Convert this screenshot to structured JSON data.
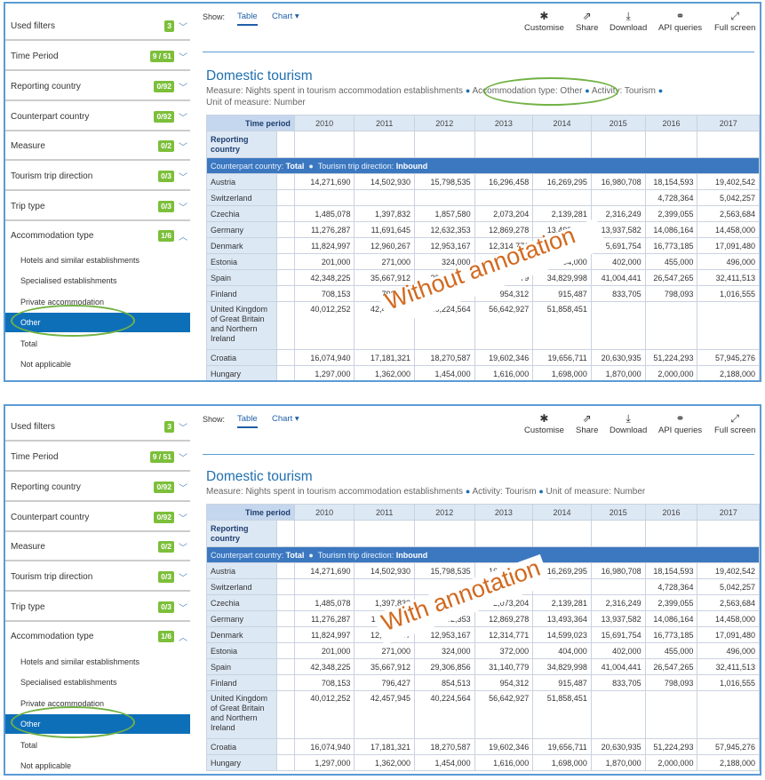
{
  "colors": {
    "accent": "#1f6fb0",
    "badge": "#7cbf3a",
    "selected": "#0e6fb9",
    "annotation_oval": "#71b244",
    "watermark": "#d2691e"
  },
  "filters": [
    {
      "label": "Used filters",
      "badge": "3"
    },
    {
      "label": "Time Period",
      "badge": "9 / 51"
    },
    {
      "label": "Reporting country",
      "badge": "0/92"
    },
    {
      "label": "Counterpart country",
      "badge": "0/92"
    },
    {
      "label": "Measure",
      "badge": "0/2"
    },
    {
      "label": "Tourism trip direction",
      "badge": "0/3"
    },
    {
      "label": "Trip type",
      "badge": "0/3"
    },
    {
      "label": "Accommodation type",
      "badge": "1/6"
    }
  ],
  "accommodation_options": [
    "Hotels and similar establishments",
    "Specialised establishments",
    "Private accommodation",
    "Other",
    "Total",
    "Not applicable"
  ],
  "toolbar": {
    "show": "Show:",
    "table": "Table",
    "chart": "Chart",
    "customise": "Customise",
    "share": "Share",
    "download": "Download",
    "api": "API queries",
    "fullscreen": "Full screen",
    "icons": [
      "gear-icon",
      "share-icon",
      "download-icon",
      "link-icon",
      "fullscreen-icon"
    ]
  },
  "title": "Domestic tourism",
  "panel1": {
    "subtitle_a": "Measure: Nights spent in tourism accommodation establishments",
    "subtitle_b": "Accommodation type: Other",
    "subtitle_c": "Activity: Tourism",
    "subtitle_d": "Unit of measure: Number",
    "watermark": "Without annotation"
  },
  "panel2": {
    "subtitle_a": "Measure: Nights spent in tourism accommodation establishments",
    "subtitle_b": "Activity: Tourism",
    "subtitle_c": "Unit of measure: Number",
    "watermark": "With annotation"
  },
  "table": {
    "time_period": "Time period",
    "reporting_country": "Reporting country",
    "years": [
      "2010",
      "2011",
      "2012",
      "2013",
      "2014",
      "2015",
      "2016",
      "2017"
    ],
    "group_a_label": "Counterpart country:",
    "group_a_value": "Total",
    "group_b_label": "Tourism trip direction:",
    "group_b_value": "Inbound",
    "rows": [
      {
        "country": "Austria",
        "v": [
          "14,271,690",
          "14,502,930",
          "15,798,535",
          "16,296,458",
          "16,269,295",
          "16,980,708",
          "18,154,593",
          "19,402,542"
        ]
      },
      {
        "country": "Switzerland",
        "v": [
          "",
          "",
          "",
          "",
          "",
          "",
          "4,728,364",
          "5,042,257"
        ]
      },
      {
        "country": "Czechia",
        "v": [
          "1,485,078",
          "1,397,832",
          "1,857,580",
          "2,073,204",
          "2,139,281",
          "2,316,249",
          "2,399,055",
          "2,563,684"
        ]
      },
      {
        "country": "Germany",
        "v": [
          "11,276,287",
          "11,691,645",
          "12,632,353",
          "12,869,278",
          "13,493,364",
          "13,937,582",
          "14,086,164",
          "14,458,000"
        ]
      },
      {
        "country": "Denmark",
        "v": [
          "11,824,997",
          "12,960,267",
          "12,953,167",
          "12,314,771",
          "14,599,023",
          "15,691,754",
          "16,773,185",
          "17,091,480"
        ]
      },
      {
        "country": "Estonia",
        "v": [
          "201,000",
          "271,000",
          "324,000",
          "372,000",
          "404,000",
          "402,000",
          "455,000",
          "496,000"
        ]
      },
      {
        "country": "Spain",
        "v": [
          "42,348,225",
          "35,667,912",
          "29,306,856",
          "31,140,779",
          "34,829,998",
          "41,004,441",
          "26,547,265",
          "32,411,513"
        ]
      },
      {
        "country": "Finland",
        "v": [
          "708,153",
          "796,427",
          "854,513",
          "954,312",
          "915,487",
          "833,705",
          "798,093",
          "1,016,555"
        ]
      },
      {
        "country": "United Kingdom of Great Britain and Northern Ireland",
        "v": [
          "40,012,252",
          "42,457,945",
          "40,224,564",
          "56,642,927",
          "51,858,451",
          "",
          "",
          ""
        ]
      },
      {
        "country": "Croatia",
        "v": [
          "16,074,940",
          "17,181,321",
          "18,270,587",
          "19,602,346",
          "19,656,711",
          "20,630,935",
          "51,224,293",
          "57,945,276"
        ]
      },
      {
        "country": "Hungary",
        "v": [
          "1,297,000",
          "1,362,000",
          "1,454,000",
          "1,616,000",
          "1,698,000",
          "1,870,000",
          "2,000,000",
          "2,188,000"
        ]
      }
    ]
  }
}
